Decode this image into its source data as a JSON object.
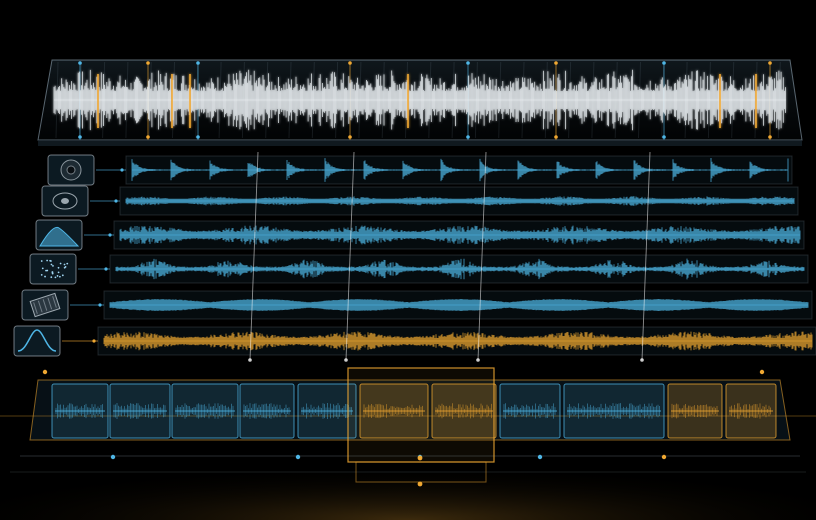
{
  "colors": {
    "background": "#000000",
    "waveform_white": "#e9eef2",
    "waveform_cyan": "#4fb6e6",
    "accent_amber": "#f0a832",
    "panel_edge": "#9fb4c4"
  },
  "master_track": {
    "name": "master-waveform",
    "marker_colors": [
      "cyan",
      "amber",
      "cyan",
      "amber",
      "cyan",
      "amber",
      "cyan",
      "amber"
    ]
  },
  "tracks": [
    {
      "name": "track-1",
      "icon": "speaker-icon",
      "color": "cyan",
      "style": "transient"
    },
    {
      "name": "track-2",
      "icon": "disc-icon",
      "color": "cyan",
      "style": "flat"
    },
    {
      "name": "track-3",
      "icon": "mountain-wave-icon",
      "color": "cyan",
      "style": "dense"
    },
    {
      "name": "track-4",
      "icon": "particles-icon",
      "color": "cyan",
      "style": "burst"
    },
    {
      "name": "track-5",
      "icon": "microchip-icon",
      "color": "cyan",
      "style": "smooth"
    },
    {
      "name": "track-6",
      "icon": "bell-curve-icon",
      "color": "amber",
      "style": "dense"
    }
  ],
  "clips": [
    {
      "color": "cyan"
    },
    {
      "color": "cyan"
    },
    {
      "color": "cyan"
    },
    {
      "color": "cyan"
    },
    {
      "color": "cyan"
    },
    {
      "color": "amber"
    },
    {
      "color": "amber"
    },
    {
      "color": "cyan"
    },
    {
      "color": "cyan"
    },
    {
      "color": "amber"
    },
    {
      "color": "amber"
    }
  ],
  "selection": {
    "color": "amber"
  }
}
